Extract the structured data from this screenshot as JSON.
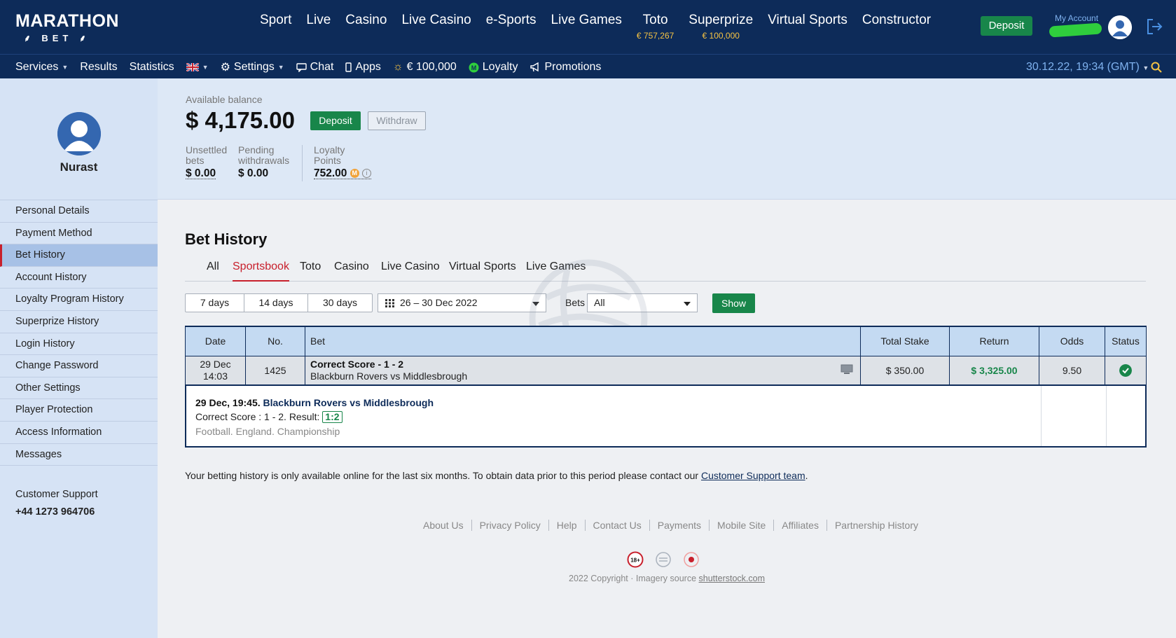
{
  "header": {
    "logo_line1": "MARATHON",
    "logo_line2": "BET",
    "nav": [
      {
        "label": "Sport",
        "sub": ""
      },
      {
        "label": "Live",
        "sub": ""
      },
      {
        "label": "Casino",
        "sub": ""
      },
      {
        "label": "Live Casino",
        "sub": ""
      },
      {
        "label": "e-Sports",
        "sub": ""
      },
      {
        "label": "Live Games",
        "sub": ""
      },
      {
        "label": "Toto",
        "sub": "€ 757,267"
      },
      {
        "label": "Superprize",
        "sub": "€ 100,000"
      },
      {
        "label": "Virtual Sports",
        "sub": ""
      },
      {
        "label": "Constructor",
        "sub": ""
      }
    ],
    "deposit_label": "Deposit",
    "my_account_label": "My Account"
  },
  "subnav": {
    "services": "Services",
    "results": "Results",
    "statistics": "Statistics",
    "settings": "Settings",
    "chat": "Chat",
    "apps": "Apps",
    "jackpot": "€ 100,000",
    "loyalty": "Loyalty",
    "promotions": "Promotions",
    "datetime": "30.12.22, 19:34 (GMT)"
  },
  "sidebar": {
    "username": "Nurast",
    "items": [
      "Personal Details",
      "Payment Method",
      "Bet History",
      "Account History",
      "Loyalty Program History",
      "Superprize History",
      "Login History",
      "Change Password",
      "Other Settings",
      "Player Protection",
      "Access Information",
      "Messages"
    ],
    "active_index": 2,
    "support_label": "Customer Support",
    "support_phone": "+44 1273 964706"
  },
  "balance": {
    "label": "Available balance",
    "amount": "$ 4,175.00",
    "deposit_label": "Deposit",
    "withdraw_label": "Withdraw",
    "unsettled_label_1": "Unsettled",
    "unsettled_label_2": "bets",
    "unsettled_value": "$ 0.00",
    "pending_label_1": "Pending",
    "pending_label_2": "withdrawals",
    "pending_value": "$ 0.00",
    "loyalty_label_1": "Loyalty",
    "loyalty_label_2": "Points",
    "loyalty_value": "752.00",
    "coin_letter": "M",
    "info_letter": "i"
  },
  "bet_history": {
    "title": "Bet History",
    "tabs": [
      "All",
      "Sportsbook",
      "Toto",
      "Casino",
      "Live Casino",
      "Virtual Sports",
      "Live Games"
    ],
    "active_tab": "Sportsbook",
    "periods": [
      "7 days",
      "14 days",
      "30 days"
    ],
    "date_range": "26 – 30 Dec 2022",
    "bets_label": "Bets",
    "bets_value": "All",
    "show_label": "Show",
    "columns": [
      "Date",
      "No.",
      "Bet",
      "Total Stake",
      "Return",
      "Odds",
      "Status"
    ],
    "rows": [
      {
        "date_1": "29 Dec",
        "date_2": "14:03",
        "no": "1425",
        "bet_title": "Correct Score - 1 - 2",
        "bet_event": "Blackburn Rovers vs Middlesbrough",
        "stake": "$ 350.00",
        "return": "$ 3,325.00",
        "odds": "9.50",
        "status": "won"
      }
    ],
    "detail": {
      "datetime": "29 Dec, 19:45.",
      "event": "Blackburn Rovers vs Middlesbrough",
      "line_prefix": "Correct Score : 1 - 2. Result:",
      "result": "1:2",
      "league": "Football. England. Championship"
    },
    "note_text": "Your betting history is only available online for the last six months. To obtain data prior to this period please contact our ",
    "note_link": "Customer Support team",
    "note_end": "."
  },
  "footer": {
    "links": [
      "About Us",
      "Privacy Policy",
      "Help",
      "Contact Us",
      "Payments",
      "Mobile Site",
      "Affiliates",
      "Partnership History"
    ],
    "age_badge": "18+",
    "copyright_prefix": "2022 Copyright · Imagery source ",
    "copyright_link": "shutterstock.com"
  },
  "colors": {
    "navy": "#0d2b59",
    "green": "#18864a",
    "red_accent": "#c8202c",
    "gold": "#f6c343"
  }
}
